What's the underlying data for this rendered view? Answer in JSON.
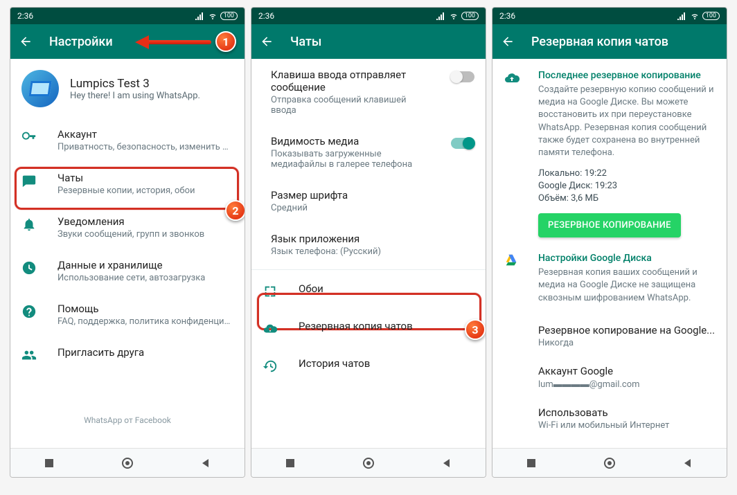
{
  "status": {
    "time": "2:36",
    "battery": "100"
  },
  "s1": {
    "title": "Настройки",
    "profile": {
      "name": "Lumpics Test 3",
      "status": "Hey there! I am using WhatsApp."
    },
    "account": {
      "title": "Аккаунт",
      "sub": "Приватность, безопасность, изменить номер"
    },
    "chats": {
      "title": "Чаты",
      "sub": "Резервные копии, история, обои"
    },
    "notif": {
      "title": "Уведомления",
      "sub": "Звуки сообщений, групп и звонков"
    },
    "data": {
      "title": "Данные и хранилище",
      "sub": "Использование сети, автозагрузка"
    },
    "help": {
      "title": "Помощь",
      "sub": "FAQ, поддержка, политика конфиденциальн..."
    },
    "invite": {
      "title": "Пригласить друга"
    },
    "footer": "WhatsApp от Facebook"
  },
  "s2": {
    "title": "Чаты",
    "enter": {
      "title": "Клавиша ввода отправляет сообщение",
      "sub": "Отправка сообщений клавишей ввода"
    },
    "media": {
      "title": "Видимость медиа",
      "sub": "Показывать загруженные медиафайлы в галерее телефона"
    },
    "font": {
      "title": "Размер шрифта",
      "sub": "Средний"
    },
    "lang": {
      "title": "Язык приложения",
      "sub": "Язык телефона: (Русский)"
    },
    "wall": {
      "title": "Обои"
    },
    "backup": {
      "title": "Резервная копия чатов"
    },
    "history": {
      "title": "История чатов"
    }
  },
  "s3": {
    "title": "Резервная копия чатов",
    "last": {
      "heading": "Последнее резервное копирование",
      "desc": "Создайте резервную копию сообщений и медиа на Google Диске. Вы можете восстановить их при переустановке WhatsApp. Резервная копия сообщений также будет сохранена во внутренней памяти телефона.",
      "local": "Локально: 19:22",
      "drive": "Google Диск: 19:23",
      "size": "Объём: 3,6 МБ",
      "btn": "РЕЗЕРВНОЕ КОПИРОВАНИЕ"
    },
    "gd": {
      "heading": "Настройки Google Диска",
      "desc": "Резервная копия ваших сообщений и медиа на Google Диске не защищена сквозным шифрованием WhatsApp."
    },
    "freq": {
      "title": "Резервное копирование на Google...",
      "sub": "Никогда"
    },
    "acct": {
      "title": "Аккаунт Google",
      "sub": "lum▬▬▬▬@gmail.com"
    },
    "net": {
      "title": "Использовать",
      "sub": "Wi-Fi или мобильный Интернет"
    }
  },
  "badges": {
    "b1": "1",
    "b2": "2",
    "b3": "3"
  }
}
